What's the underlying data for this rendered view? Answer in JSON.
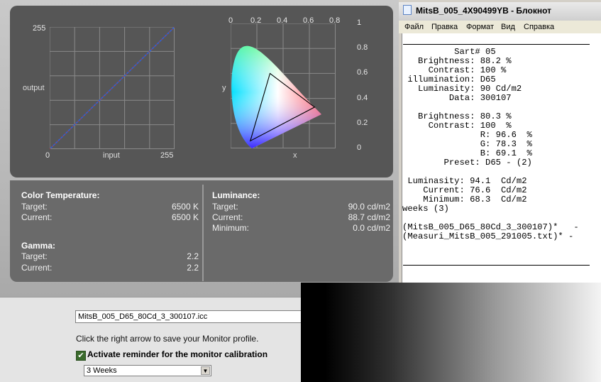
{
  "curve_chart": {
    "axis_max": "255",
    "axis_zero": "0",
    "ylabel": "output",
    "xlabel": "input",
    "x_end": "255"
  },
  "cie_chart": {
    "xlabel": "x",
    "ylabel": "y",
    "top_ticks": [
      "0",
      "0.2",
      "0.4",
      "0.6",
      "0.8"
    ],
    "right_ticks": [
      "1",
      "0.8",
      "0.6",
      "0.4",
      "0.2",
      "0"
    ]
  },
  "chart_data": [
    {
      "type": "line",
      "xlabel": "input",
      "ylabel": "output",
      "xlim": [
        0,
        255
      ],
      "ylim": [
        0,
        255
      ],
      "series": [
        {
          "values": [
            [
              0,
              0
            ],
            [
              255,
              255
            ]
          ]
        }
      ]
    },
    {
      "type": "scatter",
      "xlabel": "x",
      "ylabel": "y",
      "xlim": [
        0,
        0.8
      ],
      "ylim": [
        0,
        1
      ],
      "triangle": [
        [
          0.64,
          0.33
        ],
        [
          0.3,
          0.6
        ],
        [
          0.15,
          0.06
        ]
      ]
    }
  ],
  "color_temperature": {
    "heading": "Color Temperature:",
    "target_label": "Target:",
    "target_value": "6500 K",
    "current_label": "Current:",
    "current_value": "6500 K"
  },
  "luminance": {
    "heading": "Luminance:",
    "target_label": "Target:",
    "target_value": "90.0 cd/m2",
    "current_label": "Current:",
    "current_value": "88.7 cd/m2",
    "minimum_label": "Minimum:",
    "minimum_value": "0.0 cd/m2"
  },
  "gamma": {
    "heading": "Gamma:",
    "target_label": "Target:",
    "target_value": "2.2",
    "current_label": "Current:",
    "current_value": "2.2"
  },
  "profile": {
    "filename": "MitsB_005_D65_80Cd_3_300107.icc",
    "instruction": "Click the right arrow to save your Monitor profile.",
    "reminder_label": "Activate reminder for the monitor calibration",
    "reminder_checked": true,
    "reminder_interval": "3 Weeks"
  },
  "notepad": {
    "title": "MitsB_005_4X90499YB - Блокнот",
    "menu": [
      "Файл",
      "Правка",
      "Формат",
      "Вид",
      "Справка"
    ],
    "lines": [
      "",
      "          Sart# 05",
      "   Brightness: 88.2 %",
      "     Contrast: 100 %",
      " illumination: D65",
      "   Luminasity: 90 Cd/m2",
      "         Data: 300107",
      "",
      "   Brightness: 80.3 %",
      "     Contrast: 100  %",
      "               R: 96.6  %",
      "               G: 78.3  %",
      "               B: 69.1  %",
      "        Preset: D65 - (2)",
      "",
      " Luminasity: 94.1  Cd/m2",
      "    Current: 76.6  Cd/m2",
      "    Minimum: 68.3  Cd/m2",
      "weeks (3)",
      "",
      "(MitsB_005_D65_80Cd_3_300107)*   -",
      "(Measuri_MitsB_005_291005.txt)* -"
    ]
  }
}
